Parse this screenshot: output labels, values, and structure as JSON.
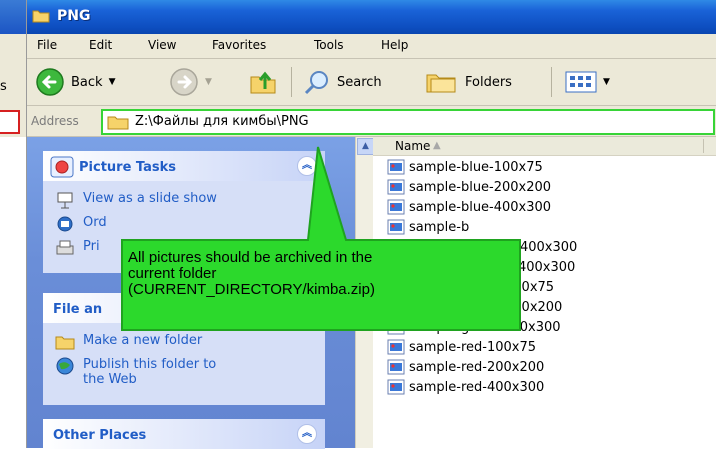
{
  "window": {
    "title": "PNG"
  },
  "left_sliver": {
    "partial_text": "s"
  },
  "menu": {
    "items": [
      "File",
      "Edit",
      "View",
      "Favorites",
      "Tools",
      "Help"
    ]
  },
  "toolbar": {
    "back": "Back",
    "search": "Search",
    "folders": "Folders"
  },
  "address": {
    "label": "Address",
    "path": "Z:\\Файлы для кимбы\\PNG"
  },
  "task_pane": {
    "picture_tasks": {
      "title": "Picture Tasks",
      "items": [
        "View as a slide show",
        "Ord",
        "Pri"
      ]
    },
    "file_tasks": {
      "title": "File an",
      "items": [
        "Make a new folder",
        "Publish this folder to",
        "the Web"
      ]
    },
    "other_places": {
      "title": "Other Places"
    }
  },
  "file_list": {
    "column_name": "Name",
    "files": [
      "sample-blue-100x75",
      "sample-blue-200x200",
      "sample-blue-400x300",
      "sample-b",
      "bee-400x300",
      "2-400x300",
      "100x75",
      "200x200",
      "sample-green-400x300",
      "sample-red-100x75",
      "sample-red-200x200",
      "sample-red-400x300"
    ]
  },
  "callout": {
    "line1": "All pictures should be archived in the",
    "line2": "current folder",
    "line3": "(CURRENT_DIRECTORY/kimba.zip)",
    "fill": "#2cd92c",
    "border": "#1fa31f"
  },
  "colors": {
    "titlebar": "#0d4ec0",
    "chrome": "#ece9d8",
    "taskpane": "#6a8ed8",
    "link": "#215dc6",
    "address_border": "#37d437"
  }
}
